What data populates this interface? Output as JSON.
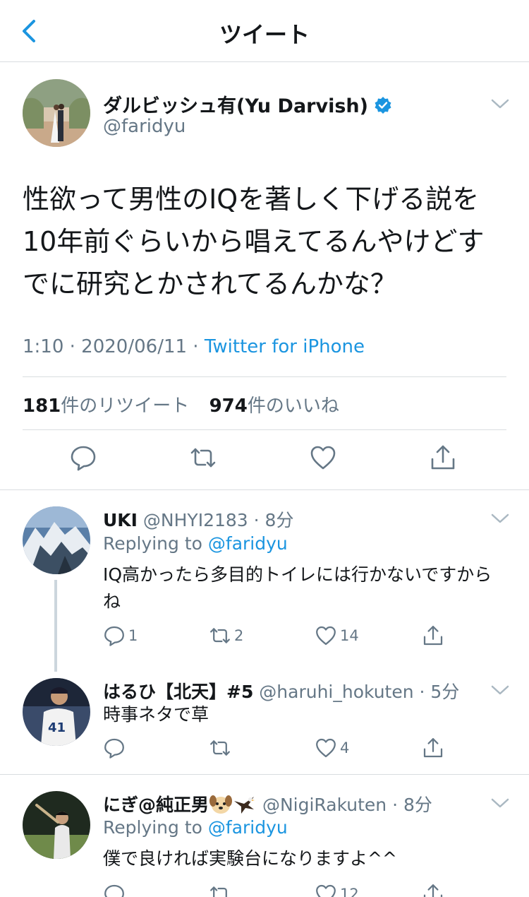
{
  "nav": {
    "title": "ツイート"
  },
  "main_tweet": {
    "name": "ダルビッシュ有(Yu Darvish)",
    "handle": "@faridyu",
    "text": "性欲って男性のIQを著しく下げる説を10年前ぐらいから唱えてるんやけどすでに研究とかされてるんかな？",
    "meta_time": "1:10 · 2020/06/11 · ",
    "meta_source": "Twitter for iPhone",
    "retweets_count": "181",
    "retweets_label": "件のリツイート",
    "likes_count": "974",
    "likes_label": "件のいいね"
  },
  "replies": [
    {
      "name": "UKI",
      "handle_time": " @NHYI2183 · 8分",
      "replying_prefix": "Replying to ",
      "replying_handle": "@faridyu",
      "text": "IQ高かったら多目的トイレには行かないですからね",
      "reply_count": "1",
      "retweet_count": "2",
      "like_count": "14"
    },
    {
      "name": "はるひ【北天】#5",
      "handle_time": " @haruhi_hokuten · 5分",
      "text": "時事ネタで草",
      "reply_count": "",
      "retweet_count": "",
      "like_count": "4"
    },
    {
      "name": "にぎ@純正男",
      "handle_time": " @NigiRakuten · 8分",
      "replying_prefix": "Replying to ",
      "replying_handle": "@faridyu",
      "text": "僕で良ければ実験台になりますよ^^",
      "reply_count": "",
      "retweet_count": "",
      "like_count": "12"
    }
  ],
  "colors": {
    "accent": "#1b95e0",
    "muted": "#657786",
    "border": "#d9dde0"
  }
}
